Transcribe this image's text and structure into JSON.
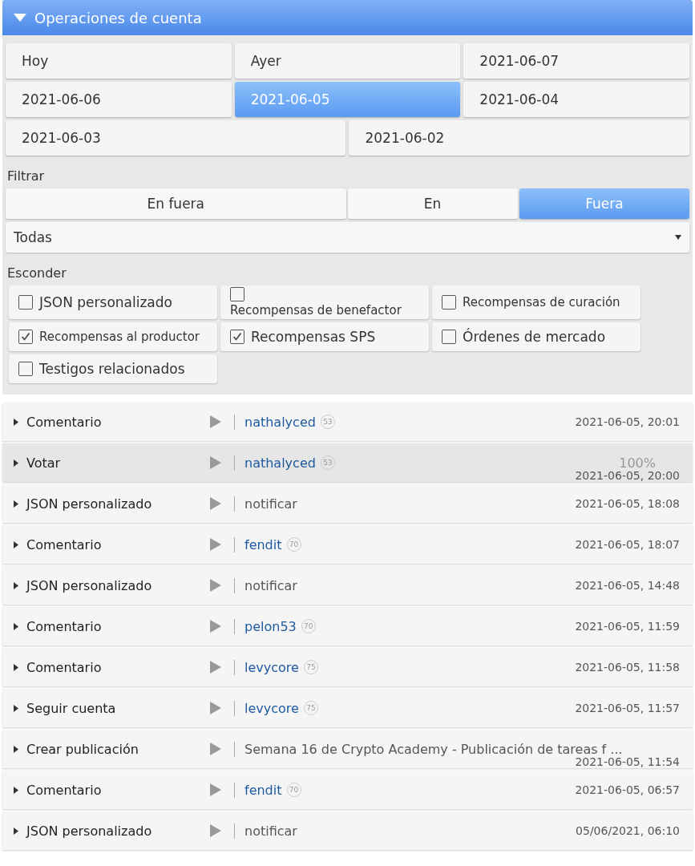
{
  "header": {
    "title": "Operaciones de cuenta",
    "expanded": true
  },
  "dates": [
    {
      "label": "Hoy",
      "selected": false
    },
    {
      "label": "Ayer",
      "selected": false
    },
    {
      "label": "2021-06-07",
      "selected": false
    },
    {
      "label": "2021-06-06",
      "selected": false
    },
    {
      "label": "2021-06-05",
      "selected": true
    },
    {
      "label": "2021-06-04",
      "selected": false
    },
    {
      "label": "2021-06-03",
      "selected": false
    },
    {
      "label": "2021-06-02",
      "selected": false
    }
  ],
  "filter": {
    "label": "Filtrar",
    "options": [
      {
        "label": "En fuera",
        "selected": false
      },
      {
        "label": "En",
        "selected": false
      },
      {
        "label": "Fuera",
        "selected": true
      }
    ],
    "dropdown": "Todas"
  },
  "hide": {
    "label": "Esconder",
    "options": [
      {
        "label": "JSON personalizado",
        "checked": false
      },
      {
        "label": "Recompensas de benefactor",
        "checked": false
      },
      {
        "label": "Recompensas de curación",
        "checked": false
      },
      {
        "label": "Recompensas al productor",
        "checked": true
      },
      {
        "label": "Recompensas SPS",
        "checked": true
      },
      {
        "label": "Órdenes de mercado",
        "checked": false
      },
      {
        "label": "Testigos relacionados",
        "checked": false
      }
    ]
  },
  "operations": [
    {
      "type": "Comentario",
      "kind": "account",
      "target": "nathalyced",
      "reputation": "53",
      "date": "2021-06-05, 20:01",
      "selected": false
    },
    {
      "type": "Votar",
      "kind": "account",
      "target": "nathalyced",
      "reputation": "53",
      "weight": "100%",
      "date": "2021-06-05, 20:00",
      "selected": true
    },
    {
      "type": "JSON personalizado",
      "kind": "text",
      "target": "notificar",
      "date": "2021-06-05, 18:08",
      "selected": false
    },
    {
      "type": "Comentario",
      "kind": "account",
      "target": "fendit",
      "reputation": "70",
      "date": "2021-06-05, 18:07",
      "selected": false
    },
    {
      "type": "JSON personalizado",
      "kind": "text",
      "target": "notificar",
      "date": "2021-06-05, 14:48",
      "selected": false
    },
    {
      "type": "Comentario",
      "kind": "account",
      "target": "pelon53",
      "reputation": "70",
      "date": "2021-06-05, 11:59",
      "selected": false
    },
    {
      "type": "Comentario",
      "kind": "account",
      "target": "levycore",
      "reputation": "75",
      "date": "2021-06-05, 11:58",
      "selected": false
    },
    {
      "type": "Seguir cuenta",
      "kind": "account",
      "target": "levycore",
      "reputation": "75",
      "date": "2021-06-05, 11:57",
      "selected": false
    },
    {
      "type": "Crear publicación",
      "kind": "text",
      "target": "Semana 16 de Crypto Academy - Publicación de tareas f ...",
      "date": "2021-06-05, 11:54",
      "selected": false
    },
    {
      "type": "Comentario",
      "kind": "account",
      "target": "fendit",
      "reputation": "70",
      "date": "2021-06-05, 06:57",
      "selected": false
    },
    {
      "type": "JSON personalizado",
      "kind": "text",
      "target": "notificar",
      "date": "05/06/2021, 06:10",
      "selected": false
    }
  ]
}
